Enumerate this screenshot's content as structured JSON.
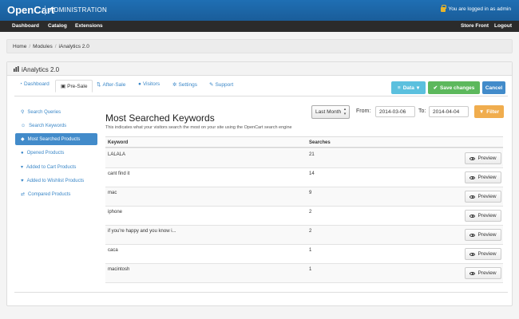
{
  "header": {
    "brand": "OpenCart",
    "section": "ADMINISTRATION",
    "logged_in": "You are logged in as admin"
  },
  "nav": {
    "left": [
      "Dashboard",
      "Catalog",
      "Extensions"
    ],
    "right": [
      "Store Front",
      "Logout"
    ]
  },
  "breadcrumb": [
    "Home",
    "Modules",
    "iAnalytics 2.0"
  ],
  "panel": {
    "title": "iAnalytics 2.0"
  },
  "tabs": [
    {
      "label": "Dashboard",
      "icon": "dashboard-icon"
    },
    {
      "label": "Pre-Sale",
      "icon": "briefcase-icon",
      "active": true
    },
    {
      "label": "After-Sale",
      "icon": "sort-icon"
    },
    {
      "label": "Visitors",
      "icon": "user-icon"
    },
    {
      "label": "Settings",
      "icon": "gears-icon"
    },
    {
      "label": "Support",
      "icon": "wrench-icon"
    }
  ],
  "actions": {
    "data": "Data",
    "save": "Save changes",
    "cancel": "Cancel"
  },
  "sidebar": [
    {
      "label": "Search Queries",
      "icon": "search-icon"
    },
    {
      "label": "Search Keywords",
      "icon": "user-icon"
    },
    {
      "label": "Most Searched Products",
      "icon": "tag-icon",
      "active": true
    },
    {
      "label": "Opened Products",
      "icon": "map-marker-icon"
    },
    {
      "label": "Added to Cart Products",
      "icon": "cart-icon"
    },
    {
      "label": "Added to Wishlist Products",
      "icon": "heart-icon"
    },
    {
      "label": "Compared Products",
      "icon": "random-icon"
    }
  ],
  "content": {
    "title": "Most Searched Keywords",
    "description": "This indicates what your visitors search the most on your site using the OpenCart search engine"
  },
  "filter": {
    "range": "Last Month",
    "from_label": "From:",
    "from": "2014-03-06",
    "to_label": "To:",
    "to": "2014-04-04",
    "button": "Filter"
  },
  "table": {
    "columns": [
      "Keyword",
      "Searches"
    ],
    "preview_label": "Preview",
    "rows": [
      {
        "keyword": "LALALA",
        "searches": "21"
      },
      {
        "keyword": "cant find it",
        "searches": "14"
      },
      {
        "keyword": "mac",
        "searches": "9"
      },
      {
        "keyword": "iphone",
        "searches": "2"
      },
      {
        "keyword": "if you're happy and you know i...",
        "searches": "2"
      },
      {
        "keyword": "caca",
        "searches": "1"
      },
      {
        "keyword": "macintosh",
        "searches": "1"
      }
    ]
  },
  "colors": {
    "header_blue": "#1f6fb4",
    "nav_dark": "#2b2b2b",
    "link_blue": "#3a87c8",
    "active_blue": "#428bca",
    "data_button": "#5bc0de",
    "save_button": "#5cb85c",
    "cancel_button": "#428bca",
    "filter_button": "#f0ad4e"
  }
}
